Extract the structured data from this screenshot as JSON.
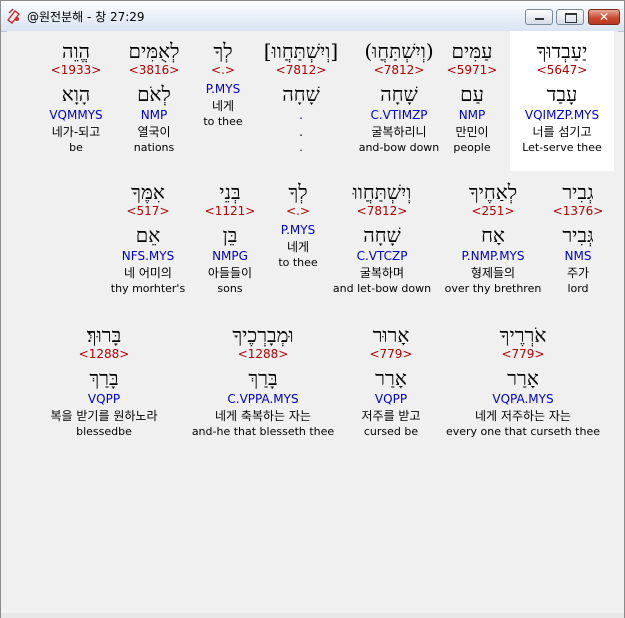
{
  "window": {
    "title": "@원전분해 - 창 27:29"
  },
  "rows": [
    [
      {
        "heb": "יַעַבְדוּךָ",
        "num": "<5647>",
        "lemma": "עָבַד",
        "pars": "VQIMZP.MYS",
        "ko": "너를 섬기고",
        "en": "Let-serve thee",
        "selected": true
      },
      {
        "heb": "עַמִּים",
        "num": "<5971>",
        "lemma": "עַם",
        "pars": "NMP",
        "ko": "만민이",
        "en": "people"
      },
      {
        "heb": "(וְיִשְׁתַּחֲוּ)",
        "num": "<7812>",
        "lemma": "שָׁחָה",
        "pars": "C.VTIMZP",
        "ko": "굴복하리니",
        "en": "and-bow down"
      },
      {
        "heb": "[וְיִשְׁתַּחֲווּ]",
        "num": "<7812>",
        "lemma": "שָׁחָה",
        "pars": ".",
        "ko": ".",
        "en": "."
      },
      {
        "heb": "לְךָ",
        "num": "<.>",
        "lemma": "",
        "pars": "P.MYS",
        "ko": "네게",
        "en": "to thee"
      },
      {
        "heb": "לְאֻמִּים",
        "num": "<3816>",
        "lemma": "לְאֹם",
        "pars": "NMP",
        "ko": "열국이",
        "en": "nations"
      },
      {
        "heb": "הֱוֵה",
        "num": "<1933>",
        "lemma": "הָוָא",
        "pars": "VQMMYS",
        "ko": "네가-되고",
        "en": "be"
      }
    ],
    [
      {
        "heb": "גְבִיר",
        "num": "<1376>",
        "lemma": "גְּבִיר",
        "pars": "NMS",
        "ko": "주가",
        "en": "lord"
      },
      {
        "heb": "לְאַחֶיךָ",
        "num": "<251>",
        "lemma": "אָח",
        "pars": "P.NMP.MYS",
        "ko": "형제들의",
        "en": "over thy brethren"
      },
      {
        "heb": "וְיִשְׁתַּחֲווּ",
        "num": "<7812>",
        "lemma": "שָׁחָה",
        "pars": "C.VTCZP",
        "ko": "굴복하며",
        "en": "and let-bow down"
      },
      {
        "heb": "לְךָ",
        "num": "<.>",
        "lemma": "",
        "pars": "P.MYS",
        "ko": "네게",
        "en": "to thee"
      },
      {
        "heb": "בְּנֵי",
        "num": "<1121>",
        "lemma": "בֵּן",
        "pars": "NMPG",
        "ko": "아들들이",
        "en": "sons"
      },
      {
        "heb": "אִמֶּךָ",
        "num": "<517>",
        "lemma": "אֵם",
        "pars": "NFS.MYS",
        "ko": "네 어미의",
        "en": "thy morhter's"
      }
    ],
    [
      {
        "heb": "אֹרְרֶיךָ",
        "num": "<779>",
        "lemma": "אָרַר",
        "pars": "VQPA.MYS",
        "ko": "네게 저주하는 자는",
        "en": "every one that curseth thee"
      },
      {
        "heb": "אָרוּר",
        "num": "<779>",
        "lemma": "אָרַר",
        "pars": "VQPP",
        "ko": "저주를 받고",
        "en": "cursed be"
      },
      {
        "heb": "וּמְבָרְכֶיךָ",
        "num": "<1288>",
        "lemma": "בָּרַךְ",
        "pars": "C.VPPA.MYS",
        "ko": "네게 축복하는 자는",
        "en": "and-he that blesseth thee"
      },
      {
        "heb": "בָּרוּךְ׃",
        "num": "<1288>",
        "lemma": "בָּרַךְ",
        "pars": "VQPP",
        "ko": "복을 받기를 원하노라",
        "en": "blessedbe"
      }
    ]
  ]
}
